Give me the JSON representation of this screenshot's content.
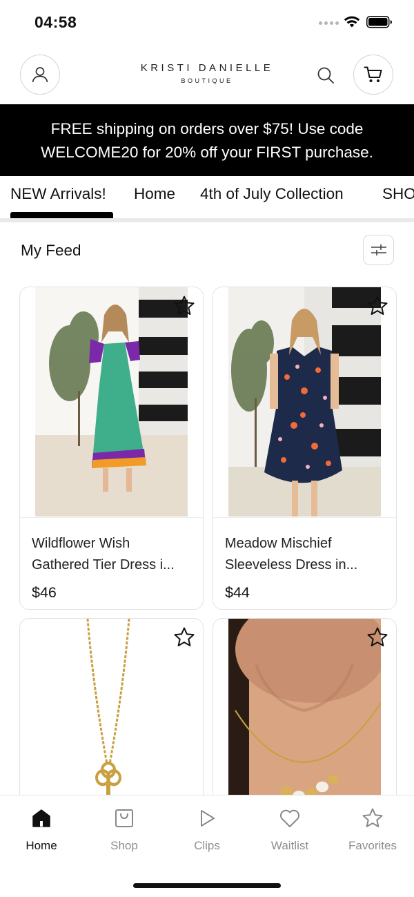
{
  "status": {
    "time": "04:58"
  },
  "header": {
    "logo_main": "KRISTI DANIELLE",
    "logo_sub": "BOUTIQUE"
  },
  "promo": {
    "line1": "FREE shipping on orders over $75! Use code",
    "line2": "WELCOME20  for 20% off your FIRST purchase."
  },
  "nav": {
    "tabs": [
      {
        "label": "NEW Arrivals!",
        "active": true
      },
      {
        "label": "Home"
      },
      {
        "label": "4th of July Collection"
      },
      {
        "label": "SHO"
      }
    ]
  },
  "feed": {
    "title": "My Feed",
    "products": [
      {
        "title_line1": "Wildflower Wish",
        "title_line2": "Gathered Tier Dress i...",
        "price": "$46"
      },
      {
        "title_line1": "Meadow Mischief",
        "title_line2": "Sleeveless Dress in...",
        "price": "$44"
      },
      {
        "title_line1": "",
        "title_line2": "",
        "price": ""
      },
      {
        "title_line1": "",
        "title_line2": "",
        "price": ""
      }
    ]
  },
  "tabbar": {
    "items": [
      {
        "label": "Home",
        "icon": "home-icon",
        "active": true
      },
      {
        "label": "Shop",
        "icon": "shopping-bag-icon"
      },
      {
        "label": "Clips",
        "icon": "play-icon"
      },
      {
        "label": "Waitlist",
        "icon": "heart-icon"
      },
      {
        "label": "Favorites",
        "icon": "star-icon"
      }
    ]
  },
  "colors": {
    "banner_bg": "#000000",
    "accent": "#000000",
    "inactive": "#8e8e8e"
  }
}
